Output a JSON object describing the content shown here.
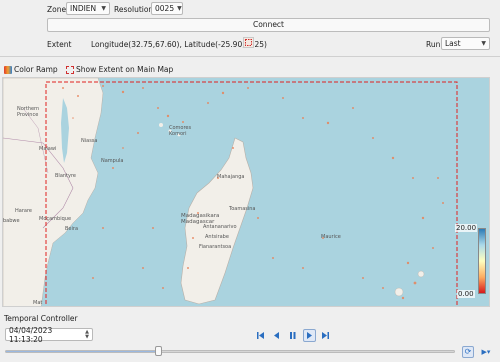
{
  "top": {
    "zone_label": "Zone",
    "zone_value": "INDIEN",
    "resolution_label": "Resolution",
    "resolution_value": "0025",
    "connect_label": "Connect"
  },
  "extent": {
    "label": "Extent",
    "value": "Longitude(32.75,67.60), Latitude(-25.90,-7.25)",
    "run_label": "Run",
    "run_value": "Last"
  },
  "options": {
    "color_ramp_label": "Color Ramp",
    "show_extent_label": "Show Extent on Main Map"
  },
  "map": {
    "labels": {
      "northern_province": "Northern\nProvince",
      "niassa": "Niassa",
      "malawi": "Malawi",
      "nampula": "Nampula",
      "blantyre": "Blantyre",
      "harare": "Harare",
      "mocambique": "Moçambique",
      "beira": "Beira",
      "zimbabwe": "babwe",
      "comores": "Comores\nKomori",
      "mahajanga": "Mahajanga",
      "toamasina": "Toamasina",
      "madagascar": "Madagasikara\nMadagascar",
      "antananarivo": "Antananarivo",
      "antsirabe": "Antsirabe",
      "fianarantsoa": "Fianarantsoa",
      "maurice": "Maurice",
      "matola": "Mat"
    },
    "ramp": {
      "max": "20.00",
      "min": "0.00",
      "colors": [
        "#2c7bb6",
        "#abd9e9",
        "#ffffbf",
        "#fdae61",
        "#d7191c"
      ]
    },
    "extent_color": "#e02020"
  },
  "temporal": {
    "title": "Temporal Controller",
    "datetime": "04/04/2023 11:13:20",
    "progress": 0.34
  }
}
